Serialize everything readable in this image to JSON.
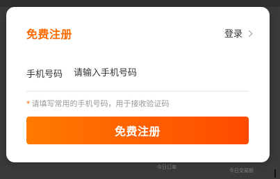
{
  "modal": {
    "title": "免费注册",
    "login_label": "登录",
    "phone": {
      "label": "手机号码",
      "placeholder": "请输入手机号码",
      "value": ""
    },
    "hint": {
      "star": "*",
      "text": "请填写常用的手机号码，用于接收验证码"
    },
    "submit_label": "免费注册"
  },
  "background": {
    "labels": [
      "今日订单",
      "今日交易额"
    ]
  },
  "colors": {
    "accent": "#ff6a00",
    "button_gradient_start": "#ff7a00",
    "button_gradient_end": "#ff4a00"
  }
}
